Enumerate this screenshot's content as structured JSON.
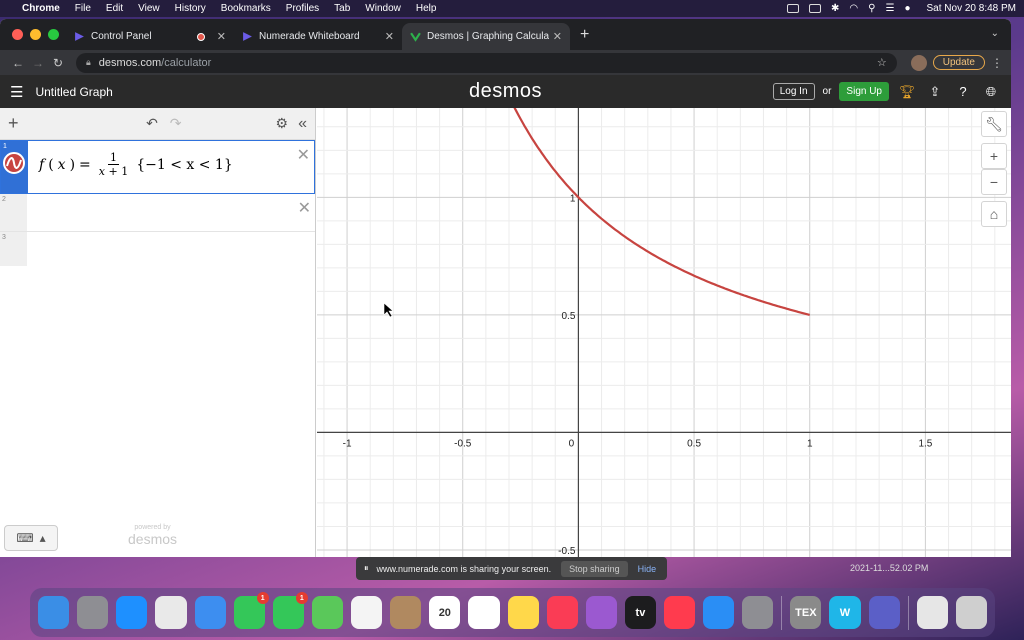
{
  "menubar": {
    "app": "Chrome",
    "items": [
      "File",
      "Edit",
      "View",
      "History",
      "Bookmarks",
      "Profiles",
      "Tab",
      "Window",
      "Help"
    ],
    "clock": "Sat Nov 20  8:48 PM"
  },
  "browser": {
    "tabs": [
      {
        "title": "Control Panel",
        "favicon_color": "#6b5ce7"
      },
      {
        "title": "Numerade Whiteboard",
        "favicon_color": "#6b5ce7"
      },
      {
        "title": "Desmos | Graphing Calculator",
        "favicon_color": "#2db14b"
      }
    ],
    "url_host": "desmos.com",
    "url_path": "/calculator",
    "update_label": "Update"
  },
  "desmos": {
    "graph_title": "Untitled Graph",
    "logo": "desmos",
    "login_label": "Log In",
    "or_label": "or",
    "signup_label": "Sign Up",
    "expressions": [
      {
        "index": "1",
        "color": "#c74440"
      },
      {
        "index": "2"
      },
      {
        "index": "3"
      }
    ],
    "math": {
      "lhs_f": "f",
      "lhs_x": "x",
      "num": "1",
      "den_x": "x",
      "den_rest": " + 1",
      "restriction": "{−1 < x < 1}"
    },
    "powered_by": "powered by",
    "powered_logo": "desmos"
  },
  "chart_data": {
    "type": "line",
    "series": [
      {
        "function": "1/(x+1)",
        "domain": [
          -1,
          1
        ],
        "color": "#c74440"
      }
    ],
    "xlim": [
      -1.13,
      1.87
    ],
    "ylim": [
      -0.53,
      1.38
    ],
    "x_ticks": [
      "-1",
      "-0.5",
      "0",
      "0.5",
      "1",
      "1.5"
    ],
    "y_ticks": [
      "1",
      "0.5",
      "-0.5"
    ],
    "grid": true
  },
  "share": {
    "message": "www.numerade.com is sharing your screen.",
    "stop_label": "Stop sharing",
    "hide_label": "Hide"
  },
  "desktop_label": "2021-11...52.02 PM",
  "dock": [
    {
      "name": "finder",
      "color": "#3a8ee6"
    },
    {
      "name": "launchpad",
      "color": "#8e8e93"
    },
    {
      "name": "safari",
      "color": "#1e90ff"
    },
    {
      "name": "chrome",
      "color": "#e9e9e9"
    },
    {
      "name": "mail",
      "color": "#3d8ef0"
    },
    {
      "name": "facetime",
      "color": "#34c759",
      "badge": "1"
    },
    {
      "name": "messages",
      "color": "#34c759",
      "badge": "1"
    },
    {
      "name": "maps",
      "color": "#5ac85a"
    },
    {
      "name": "photos",
      "color": "#f4f4f4"
    },
    {
      "name": "contacts",
      "color": "#b08960"
    },
    {
      "name": "calendar",
      "color": "#ffffff",
      "text": "20"
    },
    {
      "name": "reminders",
      "color": "#ffffff"
    },
    {
      "name": "notes",
      "color": "#ffd84a"
    },
    {
      "name": "music",
      "color": "#fa3c55"
    },
    {
      "name": "podcasts",
      "color": "#9b59d0"
    },
    {
      "name": "apple-tv",
      "color": "#1c1c1e",
      "text": "tv"
    },
    {
      "name": "news",
      "color": "#ff3b4e"
    },
    {
      "name": "app-store",
      "color": "#2a8ef5"
    },
    {
      "name": "system-preferences",
      "color": "#8e8e93"
    },
    {
      "name": "tex",
      "color": "#8a8a8a",
      "text": "TEX"
    },
    {
      "name": "webex",
      "color": "#1fb6e8",
      "text": "W"
    },
    {
      "name": "teams",
      "color": "#5b5fc7"
    },
    {
      "name": "document",
      "color": "#e6e6e6"
    },
    {
      "name": "trash",
      "color": "#cfcfcf"
    }
  ]
}
